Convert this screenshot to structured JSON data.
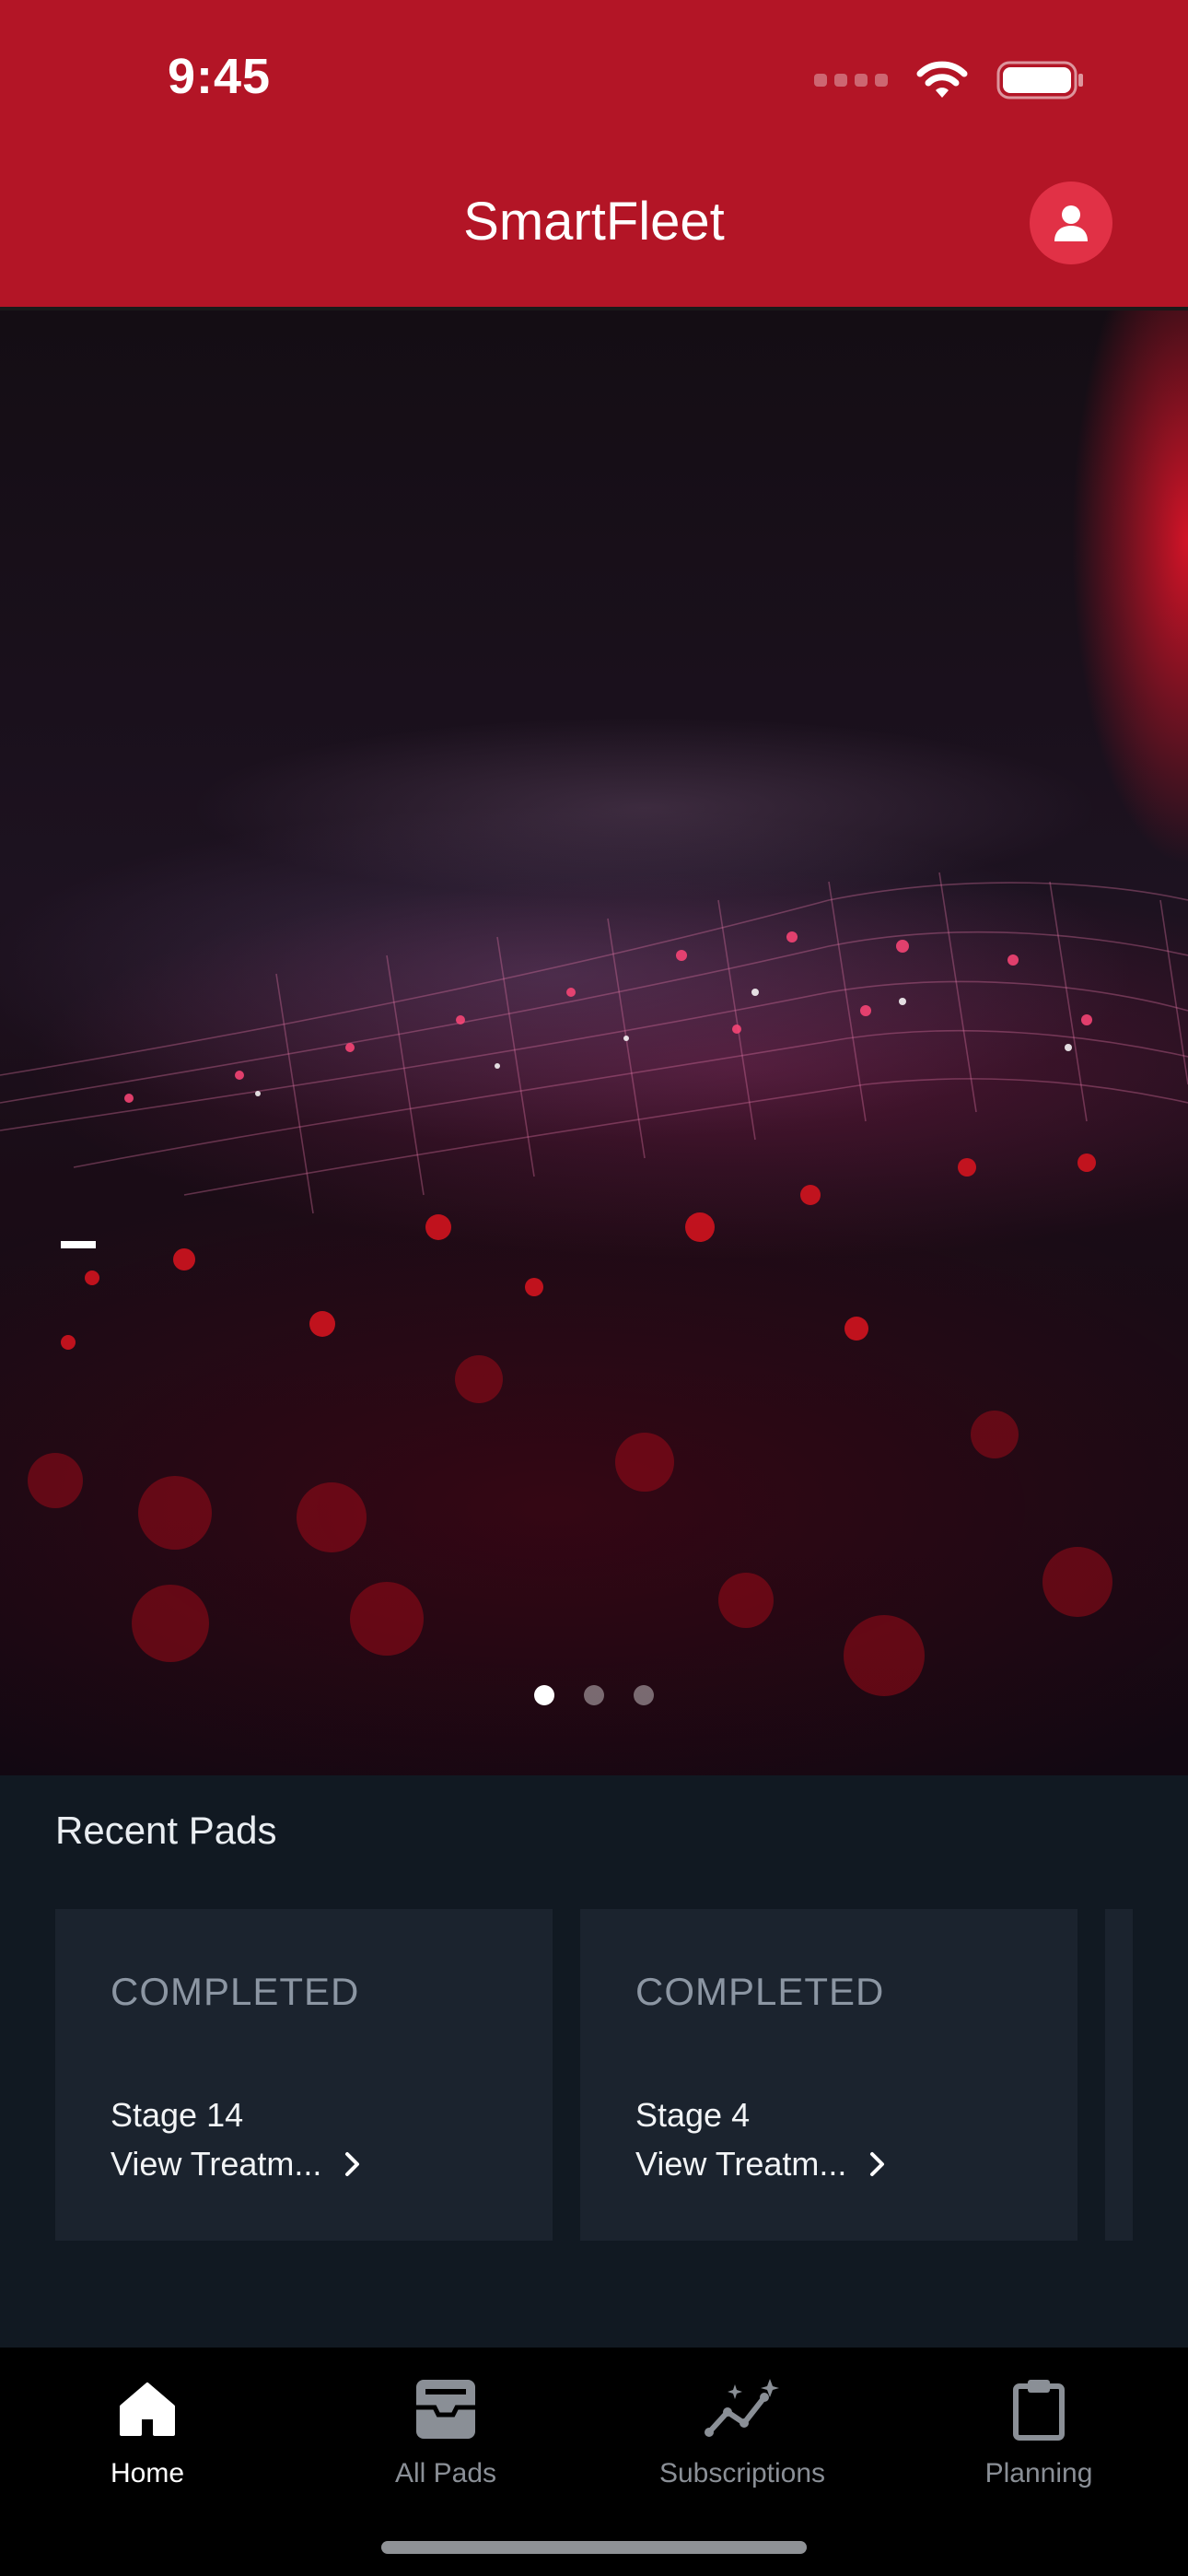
{
  "status_bar": {
    "time": "9:45"
  },
  "header": {
    "title": "SmartFleet"
  },
  "hero": {
    "slide_count": 3,
    "active_slide": 0
  },
  "recent": {
    "title": "Recent Pads",
    "cards": [
      {
        "status": "COMPLETED",
        "stage": "Stage 14",
        "link": "View Treatm..."
      },
      {
        "status": "COMPLETED",
        "stage": "Stage 4",
        "link": "View Treatm..."
      }
    ]
  },
  "tabs": [
    {
      "label": "Home",
      "icon": "home-icon",
      "active": true
    },
    {
      "label": "All Pads",
      "icon": "inbox-tray-icon",
      "active": false
    },
    {
      "label": "Subscriptions",
      "icon": "sparkle-chart-icon",
      "active": false
    },
    {
      "label": "Planning",
      "icon": "clipboard-icon",
      "active": false
    }
  ],
  "colors": {
    "brand": "#b31526",
    "profile": "#e13146",
    "panel": "#111922",
    "card": "#1b232e"
  }
}
